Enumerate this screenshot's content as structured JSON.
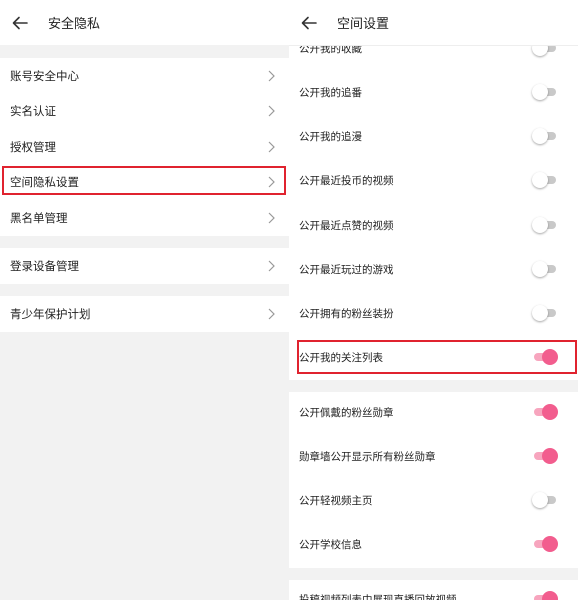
{
  "left": {
    "title": "安全隐私",
    "group1": [
      "账号安全中心",
      "实名认证",
      "授权管理",
      "空间隐私设置",
      "黑名单管理"
    ],
    "group2": [
      "登录设备管理"
    ],
    "group3": [
      "青少年保护计划"
    ]
  },
  "right": {
    "title": "空间设置",
    "items": [
      {
        "label": "公开我的收藏",
        "on": false
      },
      {
        "label": "公开我的追番",
        "on": false
      },
      {
        "label": "公开我的追漫",
        "on": false
      },
      {
        "label": "公开最近投币的视频",
        "on": false
      },
      {
        "label": "公开最近点赞的视频",
        "on": false
      },
      {
        "label": "公开最近玩过的游戏",
        "on": false
      },
      {
        "label": "公开拥有的粉丝装扮",
        "on": false
      },
      {
        "label": "公开我的关注列表",
        "on": true
      },
      {
        "label": "公开佩戴的粉丝勋章",
        "on": true
      },
      {
        "label": "勋章墙公开显示所有粉丝勋章",
        "on": true
      },
      {
        "label": "公开轻视频主页",
        "on": false
      },
      {
        "label": "公开学校信息",
        "on": true
      },
      {
        "label": "投稿视频列表中展现直播回放视频",
        "on": true
      }
    ]
  },
  "colors": {
    "accent": "#f25d8e",
    "highlight": "#e0232f"
  }
}
